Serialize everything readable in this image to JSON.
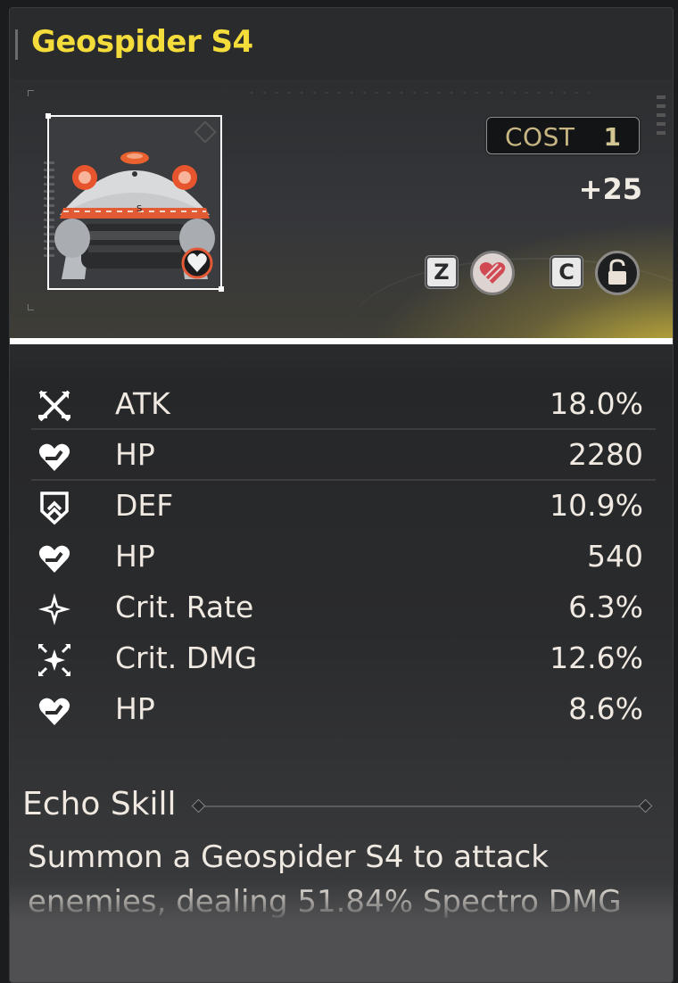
{
  "echo": {
    "name": "Geospider S4",
    "cost_label": "COST",
    "cost_value": "1",
    "level": "+25"
  },
  "hotkeys": {
    "favorite": "Z",
    "lock": "C"
  },
  "icons": {
    "portrait_badge": "heart-sonata-icon",
    "favorite": "heart-favorite-icon",
    "lock": "padlock-icon"
  },
  "stats": [
    {
      "icon": "atk-crossed-swords-icon",
      "name": "ATK",
      "value": "18.0%"
    },
    {
      "icon": "hp-heart-icon",
      "name": "HP",
      "value": "2280"
    },
    {
      "icon": "def-shield-icon",
      "name": "DEF",
      "value": "10.9%"
    },
    {
      "icon": "hp-heart-icon",
      "name": "HP",
      "value": "540"
    },
    {
      "icon": "crit-rate-star-icon",
      "name": "Crit. Rate",
      "value": "6.3%"
    },
    {
      "icon": "crit-dmg-stars-icon",
      "name": "Crit. DMG",
      "value": "12.6%"
    },
    {
      "icon": "hp-heart-icon",
      "name": "HP",
      "value": "8.6%"
    }
  ],
  "skill": {
    "title": "Echo Skill",
    "description": "Summon a Geospider S4 to attack enemies, dealing 51.84% Spectro DMG"
  },
  "colors": {
    "title": "#f4dc3a",
    "banner_glow": "#dec63c",
    "cost_text": "#c8b783"
  }
}
